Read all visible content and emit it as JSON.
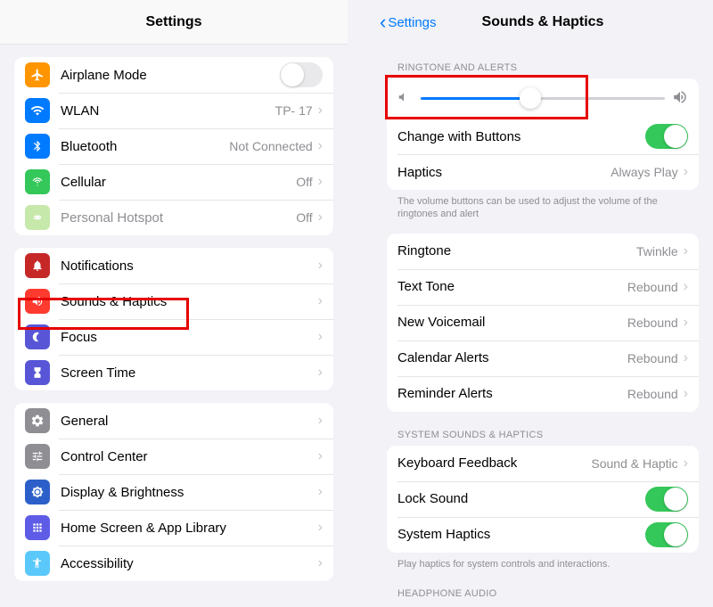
{
  "left": {
    "title": "Settings",
    "section1": {
      "airplane": {
        "label": "Airplane Mode"
      },
      "wlan": {
        "label": "WLAN",
        "value": "TP- 17"
      },
      "bluetooth": {
        "label": "Bluetooth",
        "value": "Not Connected"
      },
      "cellular": {
        "label": "Cellular",
        "value": "Off"
      },
      "hotspot": {
        "label": "Personal Hotspot",
        "value": "Off"
      }
    },
    "section2": {
      "notifications": {
        "label": "Notifications"
      },
      "sounds": {
        "label": "Sounds & Haptics"
      },
      "focus": {
        "label": "Focus"
      },
      "screentime": {
        "label": "Screen Time"
      }
    },
    "section3": {
      "general": {
        "label": "General"
      },
      "control": {
        "label": "Control Center"
      },
      "display": {
        "label": "Display & Brightness"
      },
      "home": {
        "label": "Home Screen & App Library"
      },
      "accessibility": {
        "label": "Accessibility"
      }
    }
  },
  "right": {
    "back": "Settings",
    "title": "Sounds & Haptics",
    "groups": {
      "ringtone": {
        "header": "RINGTONE AND ALERTS",
        "change_buttons": {
          "label": "Change with Buttons"
        },
        "haptics": {
          "label": "Haptics",
          "value": "Always Play"
        },
        "footer": "The volume buttons can be used to adjust the volume of the ringtones and alert"
      },
      "sounds": {
        "ringtone": {
          "label": "Ringtone",
          "value": "Twinkle"
        },
        "text": {
          "label": "Text Tone",
          "value": "Rebound"
        },
        "voicemail": {
          "label": "New Voicemail",
          "value": "Rebound"
        },
        "calendar": {
          "label": "Calendar Alerts",
          "value": "Rebound"
        },
        "reminder": {
          "label": "Reminder Alerts",
          "value": "Rebound"
        }
      },
      "system": {
        "header": "SYSTEM SOUNDS & HAPTICS",
        "keyboard": {
          "label": "Keyboard Feedback",
          "value": "Sound & Haptic"
        },
        "lock": {
          "label": "Lock Sound"
        },
        "sys_haptics": {
          "label": "System Haptics"
        },
        "footer": "Play haptics for system controls and interactions."
      },
      "headphone": {
        "header": "HEADPHONE AUDIO"
      }
    },
    "slider_percent": 45
  }
}
